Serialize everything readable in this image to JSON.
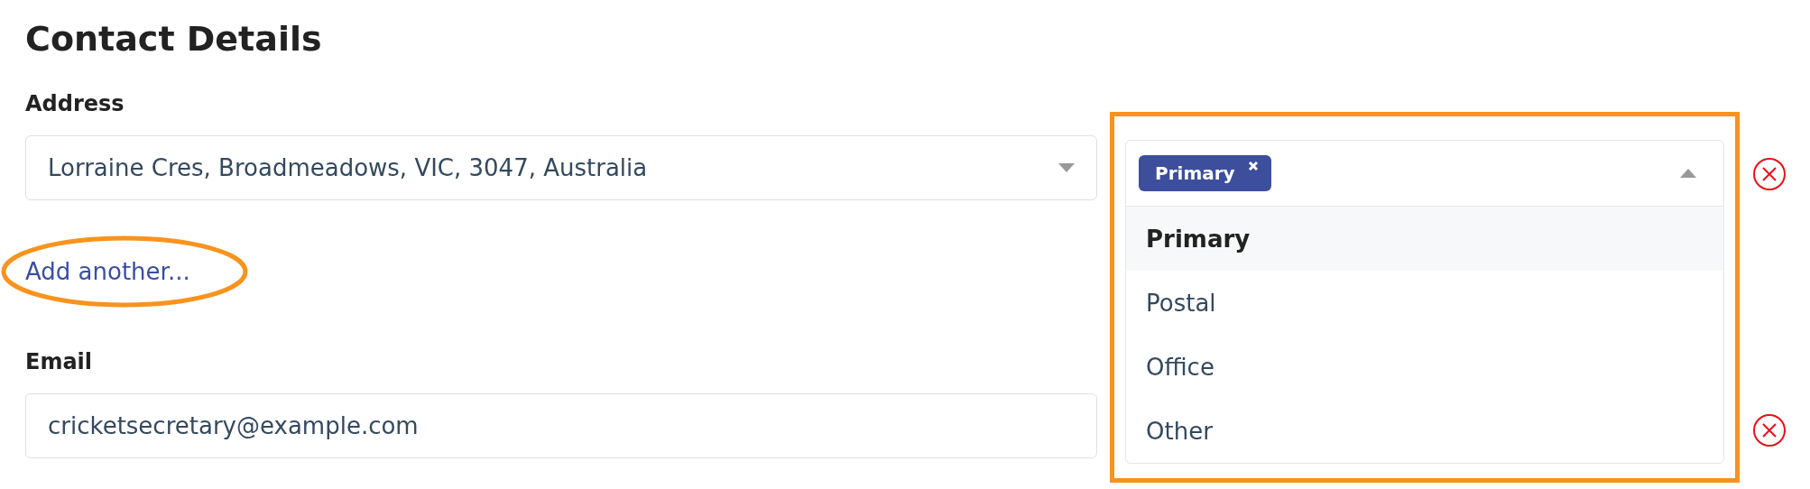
{
  "title": "Contact Details",
  "address": {
    "label": "Address",
    "value": "Lorraine Cres, Broadmeadows, VIC, 3047, Australia",
    "expanded": false
  },
  "add_link": "Add another...",
  "email": {
    "label": "Email",
    "value": "cricketsecretary@example.com"
  },
  "type_select": {
    "expanded": true,
    "tags": [
      "Primary"
    ],
    "options": [
      {
        "label": "Primary",
        "selected": true
      },
      {
        "label": "Postal",
        "selected": false
      },
      {
        "label": "Office",
        "selected": false
      },
      {
        "label": "Other",
        "selected": false
      }
    ]
  }
}
